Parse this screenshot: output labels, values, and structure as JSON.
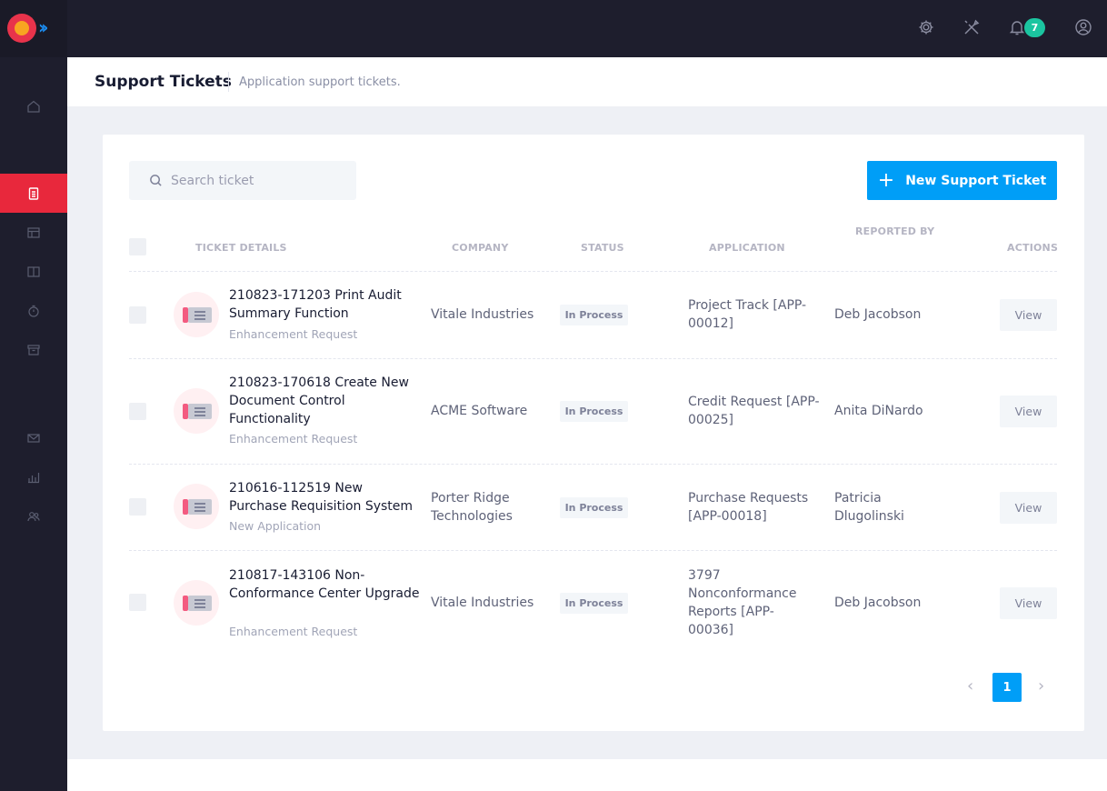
{
  "header": {
    "notification_count": "7"
  },
  "sidebar": {
    "items": [
      "home-icon",
      "document-icon",
      "table-icon",
      "book-icon",
      "timer-icon",
      "archive-icon",
      "mail-icon",
      "chart-icon",
      "users-icon"
    ],
    "active_item": "document-icon",
    "active_color": "#e8283c"
  },
  "page": {
    "title": "Support Tickets",
    "subtitle": "Application support tickets."
  },
  "toolbar": {
    "search_placeholder": "Search ticket",
    "new_ticket_label": "New Support Ticket"
  },
  "table": {
    "headers": {
      "ticket_details": "TICKET DETAILS",
      "company": "COMPANY",
      "status": "STATUS",
      "application": "APPLICATION",
      "reported_by": "REPORTED BY",
      "actions": "ACTIONS"
    },
    "rows": [
      {
        "title": "210823-171203 Print Audit Summary Function",
        "type": "Enhancement Request",
        "company": "Vitale Industries",
        "status": "In Process",
        "application": "Project Track [APP-00012]",
        "reported_by": "Deb Jacobson",
        "action": "View"
      },
      {
        "title": "210823-170618 Create New Document Control Functionality",
        "type": "Enhancement Request",
        "company": "ACME Software",
        "status": "In Process",
        "application": "Credit Request [APP-00025]",
        "reported_by": "Anita DiNardo",
        "action": "View"
      },
      {
        "title": "210616-112519 New Purchase Requisition System",
        "type": "New Application",
        "company": "Porter Ridge Technologies",
        "status": "In Process",
        "application": "Purchase Requests [APP-00018]",
        "reported_by": "Patricia Dlugolinski",
        "action": "View"
      },
      {
        "title": "210817-143106 Non-Conformance Center Upgrade",
        "type": "Enhancement Request",
        "company": "Vitale Industries",
        "status": "In Process",
        "application": "3797 Nonconformance Reports [APP-00036]",
        "reported_by": "Deb Jacobson",
        "action": "View"
      }
    ]
  },
  "pagination": {
    "current_page": "1",
    "prev_icon": "chevron-left-icon",
    "next_icon": "chevron-right-icon"
  },
  "colors": {
    "primary": "#009ef7",
    "sidebar_bg": "#1e1e2d",
    "badge": "#1bc5a0"
  }
}
